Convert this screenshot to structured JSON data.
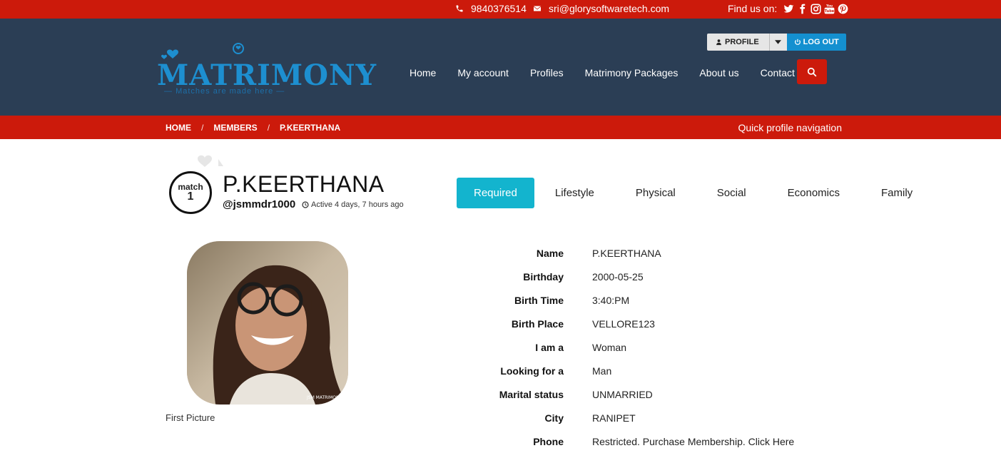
{
  "topbar": {
    "phone": "9840376514",
    "email": "sri@glorysoftwaretech.com",
    "find_us": "Find us on:",
    "social_icons": [
      "twitter-icon",
      "facebook-icon",
      "instagram-icon",
      "youtube-icon",
      "pinterest-icon"
    ]
  },
  "header": {
    "logo_text": "MATRIMONY",
    "logo_tagline": "Matches are made here",
    "nav": [
      "Home",
      "My account",
      "Profiles",
      "Matrimony Packages",
      "About us",
      "Contact"
    ],
    "profile_button": "PROFILE",
    "logout_button": "LOG OUT"
  },
  "breadcrumb": {
    "items": [
      "HOME",
      "MEMBERS",
      "P.KEERTHANA"
    ],
    "separator": "/",
    "quick_nav": "Quick profile navigation"
  },
  "profile": {
    "match_label": "match",
    "match_number": "1",
    "name": "P.KEERTHANA",
    "username": "@jsmmdr1000",
    "active": "Active 4 days, 7 hours ago",
    "photo_caption": "First Picture",
    "photo_watermark": "JSM MATRIMONY"
  },
  "tabs": [
    "Required",
    "Lifestyle",
    "Physical",
    "Social",
    "Economics",
    "Family"
  ],
  "details": [
    {
      "label": "Name",
      "value": "P.KEERTHANA"
    },
    {
      "label": "Birthday",
      "value": "2000-05-25"
    },
    {
      "label": "Birth Time",
      "value": "3:40:PM"
    },
    {
      "label": "Birth Place",
      "value": "VELLORE123"
    },
    {
      "label": "I am a",
      "value": "Woman"
    },
    {
      "label": "Looking for a",
      "value": "Man"
    },
    {
      "label": "Marital status",
      "value": "UNMARRIED"
    },
    {
      "label": "City",
      "value": "RANIPET"
    },
    {
      "label": "Phone",
      "value": "Restricted. Purchase Membership. Click Here"
    }
  ],
  "colors": {
    "red": "#cc1a0b",
    "navy": "#2b3e55",
    "cyan": "#13b4ce",
    "blue": "#1490d0"
  }
}
